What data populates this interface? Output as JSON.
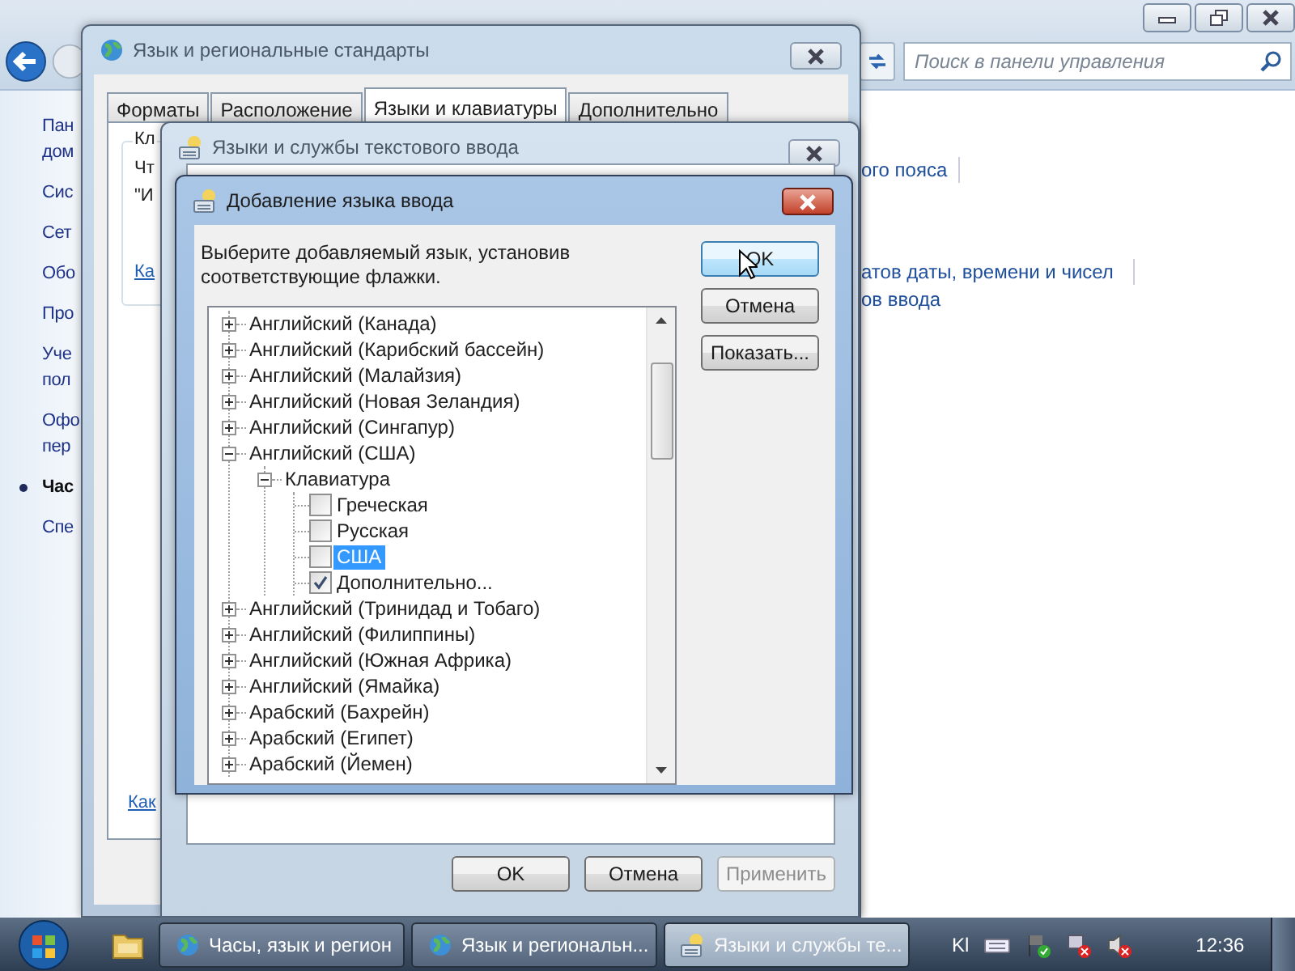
{
  "control_panel": {
    "search": {
      "placeholder": "Поиск в панели управления"
    },
    "nav_items": [
      {
        "lines": [
          "Пан",
          "дом"
        ],
        "current": false
      },
      {
        "lines": [
          "Сис"
        ],
        "current": false
      },
      {
        "lines": [
          "Сет"
        ],
        "current": false
      },
      {
        "lines": [
          "Обо"
        ],
        "current": false
      },
      {
        "lines": [
          "Про"
        ],
        "current": false
      },
      {
        "lines": [
          "Уче",
          "пол"
        ],
        "current": false
      },
      {
        "lines": [
          "Офо",
          "пер"
        ],
        "current": false
      },
      {
        "lines": [
          "Час"
        ],
        "current": true
      },
      {
        "lines": [
          "Спе"
        ],
        "current": false
      }
    ],
    "links": [
      "ого пояса",
      "атов даты, времени и чисел",
      "ов ввода"
    ]
  },
  "regional_window": {
    "title": "Язык и региональные стандарты",
    "tabs": [
      {
        "label": "Форматы",
        "selected": false
      },
      {
        "label": "Расположение",
        "selected": false
      },
      {
        "label": "Языки и клавиатуры",
        "selected": true
      },
      {
        "label": "Дополнительно",
        "selected": false
      }
    ],
    "group_label": "Кл",
    "lines": [
      "Чт",
      "\"И"
    ],
    "links": [
      "Ка",
      "Как"
    ]
  },
  "text_services_window": {
    "title": "Языки и службы текстового ввода",
    "buttons": [
      {
        "label": "OK",
        "disabled": false
      },
      {
        "label": "Отмена",
        "disabled": false
      },
      {
        "label": "Применить",
        "disabled": true
      }
    ]
  },
  "add_language_dialog": {
    "title": "Добавление языка ввода",
    "instruction": "Выберите добавляемый язык, установив соответствующие флажки.",
    "tree": [
      {
        "label": "Английский (Канада)",
        "kind": "group",
        "expanded": false,
        "selected": false
      },
      {
        "label": "Английский (Карибский бассейн)",
        "kind": "group",
        "expanded": false,
        "selected": false
      },
      {
        "label": "Английский (Малайзия)",
        "kind": "group",
        "expanded": false,
        "selected": false
      },
      {
        "label": "Английский (Новая Зеландия)",
        "kind": "group",
        "expanded": false,
        "selected": false
      },
      {
        "label": "Английский (Сингапур)",
        "kind": "group",
        "expanded": false,
        "selected": false
      },
      {
        "label": "Английский (США)",
        "kind": "group",
        "expanded": true,
        "selected": false,
        "children": [
          {
            "label": "Клавиатура",
            "kind": "group",
            "expanded": true,
            "selected": false,
            "children": [
              {
                "label": "Греческая",
                "kind": "checkbox",
                "checked": false,
                "selected": false
              },
              {
                "label": "Русская",
                "kind": "checkbox",
                "checked": false,
                "selected": false
              },
              {
                "label": "США",
                "kind": "checkbox",
                "checked": false,
                "selected": true
              },
              {
                "label": "Дополнительно...",
                "kind": "checkbox",
                "checked": true,
                "selected": false
              }
            ]
          }
        ]
      },
      {
        "label": "Английский (Тринидад и Тобаго)",
        "kind": "group",
        "expanded": false,
        "selected": false
      },
      {
        "label": "Английский (Филиппины)",
        "kind": "group",
        "expanded": false,
        "selected": false
      },
      {
        "label": "Английский (Южная Африка)",
        "kind": "group",
        "expanded": false,
        "selected": false
      },
      {
        "label": "Английский (Ямайка)",
        "kind": "group",
        "expanded": false,
        "selected": false
      },
      {
        "label": "Арабский (Бахрейн)",
        "kind": "group",
        "expanded": false,
        "selected": false
      },
      {
        "label": "Арабский (Египет)",
        "kind": "group",
        "expanded": false,
        "selected": false
      },
      {
        "label": "Арабский (Йемен)",
        "kind": "group",
        "expanded": false,
        "selected": false
      }
    ],
    "buttons": [
      {
        "label": "OK",
        "default": true
      },
      {
        "label": "Отмена",
        "default": false
      },
      {
        "label": "Показать...",
        "default": false
      }
    ]
  },
  "taskbar": {
    "buttons": [
      {
        "label": "Часы, язык и регион",
        "active": false
      },
      {
        "label": "Язык и региональн...",
        "active": false
      },
      {
        "label": "Языки и службы те...",
        "active": true
      }
    ],
    "tray_language": "Kl",
    "clock": "12:36"
  }
}
